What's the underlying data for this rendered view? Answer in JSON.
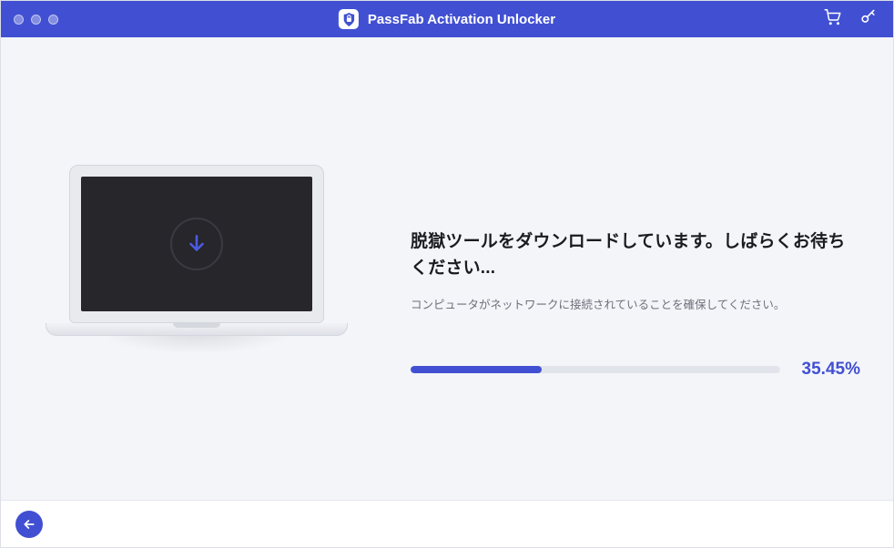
{
  "header": {
    "title": "PassFab Activation Unlocker"
  },
  "content": {
    "heading": "脱獄ツールをダウンロードしています。しばらくお待ちください...",
    "subtext": "コンピュータがネットワークに接続されていることを確保してください。"
  },
  "progress": {
    "percent_label": "35.45%",
    "percent_value": "35.45"
  },
  "colors": {
    "accent": "#4150d2"
  }
}
